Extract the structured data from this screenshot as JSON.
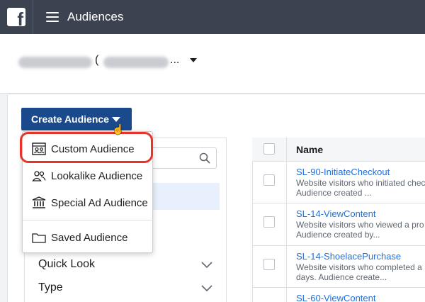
{
  "header": {
    "title": "Audiences",
    "logo_letter": "f"
  },
  "account": {
    "paren": "(",
    "ellipsis": "..."
  },
  "toolbar": {
    "create_label": "Create Audience"
  },
  "dropdown": {
    "items": [
      {
        "label": "Custom Audience",
        "icon": "custom-audience-icon"
      },
      {
        "label": "Lookalike Audience",
        "icon": "people-icon"
      },
      {
        "label": "Special Ad Audience",
        "icon": "institution-icon"
      },
      {
        "label": "Saved Audience",
        "icon": "folder-icon"
      }
    ]
  },
  "filters": {
    "items": [
      {
        "label": "Quick Look"
      },
      {
        "label": "Type"
      }
    ]
  },
  "table": {
    "header_name": "Name",
    "rows": [
      {
        "name": "SL-90-InitiateCheckout",
        "desc1": "Website visitors who initiated chec",
        "desc2": "Audience created ..."
      },
      {
        "name": "SL-14-ViewContent",
        "desc1": "Website visitors who viewed a pro",
        "desc2": "Audience created by..."
      },
      {
        "name": "SL-14-ShoelacePurchase",
        "desc1": "Website visitors who completed a",
        "desc2": "days. Audience create..."
      },
      {
        "name": "SL-60-ViewContent"
      }
    ]
  },
  "colors": {
    "topbar": "#3b4350",
    "primary_button": "#1a4a8c",
    "link": "#216fdb",
    "highlight_ring": "#e8332b"
  }
}
